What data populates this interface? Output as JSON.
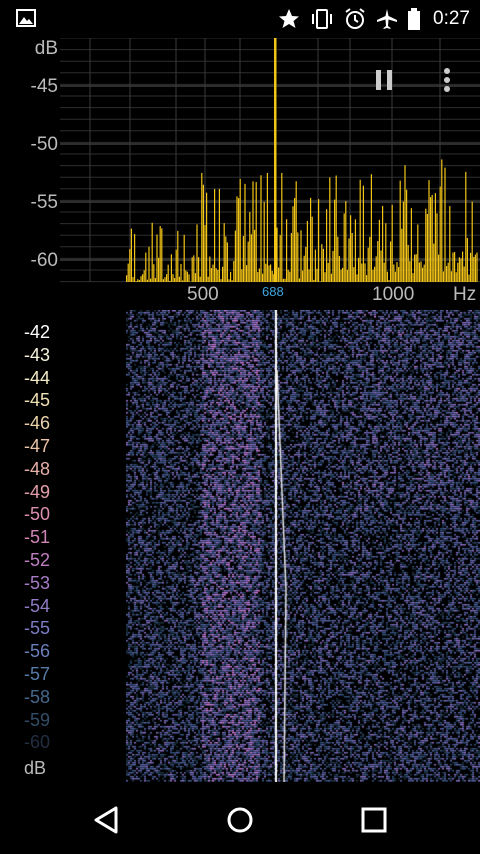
{
  "status_bar": {
    "time": "0:27",
    "icons": [
      "image-icon",
      "star-icon",
      "vibrate-icon",
      "alarm-icon",
      "airplane-icon",
      "battery-icon"
    ]
  },
  "spectrum": {
    "db_unit": "dB",
    "db_ticks": [
      "-45",
      "-50",
      "-55",
      "-60"
    ],
    "freq_ticks": [
      "500",
      "1000"
    ],
    "freq_unit": "Hz",
    "peak_label": "688",
    "bar_color": "#f2c417",
    "grid_color": "#5a5a5a",
    "actions": [
      "pause-icon",
      "more-vert-icon"
    ]
  },
  "waterfall": {
    "scale": [
      "-42",
      "-43",
      "-44",
      "-45",
      "-46",
      "-47",
      "-48",
      "-49",
      "-50",
      "-51",
      "-52",
      "-53",
      "-54",
      "-55",
      "-56",
      "-57",
      "-58",
      "-59",
      "-60"
    ],
    "unit": "dB"
  },
  "navigation": {
    "buttons": [
      "back-icon",
      "home-icon",
      "recents-icon"
    ]
  }
}
